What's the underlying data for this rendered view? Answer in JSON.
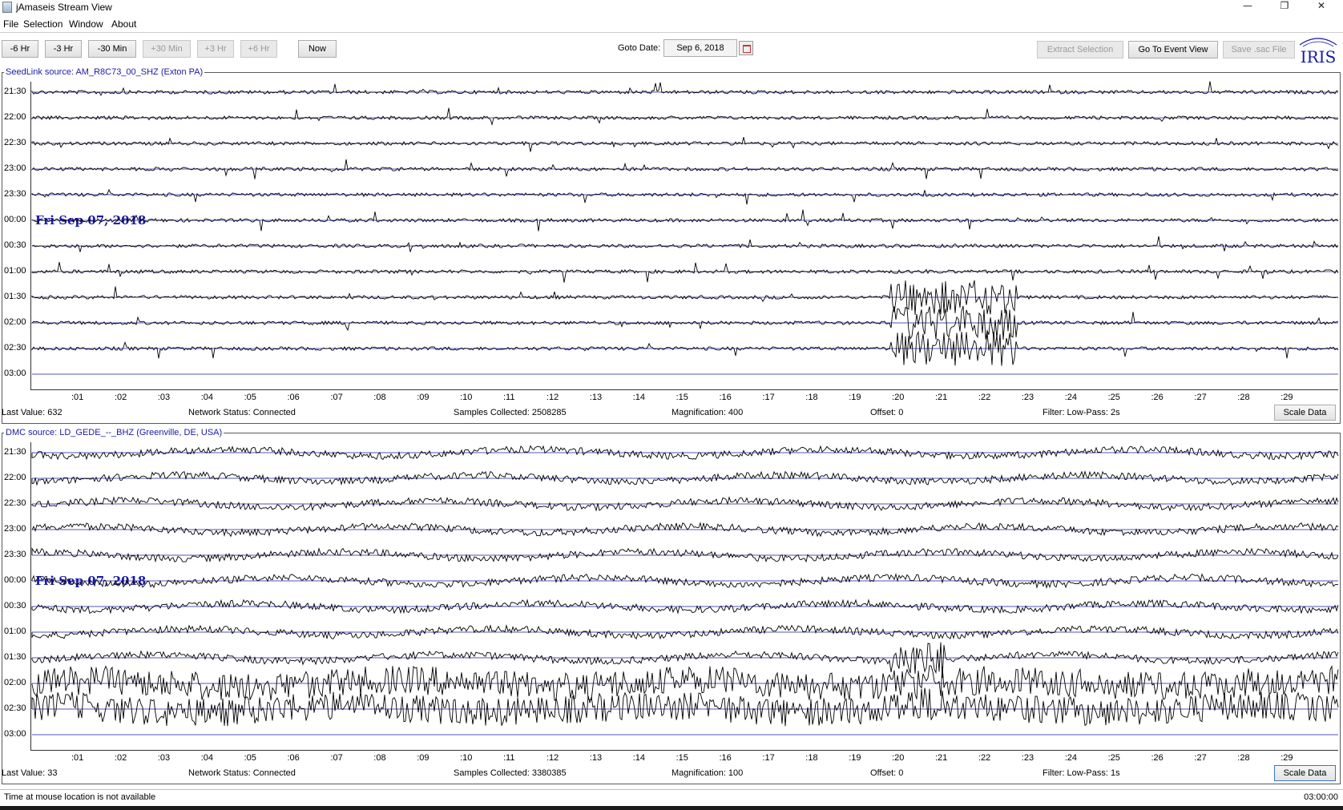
{
  "window": {
    "title": "jAmaseis Stream View",
    "minimize_icon": "minimize-icon",
    "maximize_icon": "restore-icon",
    "close_icon": "close-icon"
  },
  "menu": [
    "File",
    "Selection",
    "Window",
    "About"
  ],
  "toolbar": {
    "nav_buttons": [
      {
        "label": "-6 Hr",
        "enabled": true
      },
      {
        "label": "-3 Hr",
        "enabled": true
      },
      {
        "label": "-30 Min",
        "enabled": true
      },
      {
        "label": "+30 Min",
        "enabled": false
      },
      {
        "label": "+3 Hr",
        "enabled": false
      },
      {
        "label": "+6 Hr",
        "enabled": false
      },
      {
        "label": "Now",
        "enabled": true
      }
    ],
    "goto_label": "Goto Date:",
    "goto_value": "Sep 6, 2018",
    "extract_label": "Extract Selection",
    "event_view_label": "Go To Event View",
    "save_sac_label": "Save .sac File",
    "logo_text": "IRIS"
  },
  "row_labels": [
    "21:30",
    "22:00",
    "22:30",
    "23:00",
    "23:30",
    "00:00",
    "00:30",
    "01:00",
    "01:30",
    "02:00",
    "02:30",
    "03:00"
  ],
  "minute_ticks": [
    ":01",
    ":02",
    ":03",
    ":04",
    ":05",
    ":06",
    ":07",
    ":08",
    ":09",
    ":10",
    ":11",
    ":12",
    ":13",
    ":14",
    ":15",
    ":16",
    ":17",
    ":18",
    ":19",
    ":20",
    ":21",
    ":22",
    ":23",
    ":24",
    ":25",
    ":26",
    ":27",
    ":28",
    ":29"
  ],
  "panels": [
    {
      "source": "SeedLink source: AM_R8C73_00_SHZ (Exton PA)",
      "date_stamp": "Fri Sep 07, 2018",
      "status": {
        "last_value": "Last Value:  632",
        "network": "Network Status:  Connected",
        "samples": "Samples Collected:  2508285",
        "magnification": "Magnification:  400",
        "offset": "Offset:  0",
        "filter": "Filter:  Low-Pass: 2s"
      },
      "scale_label": "Scale Data"
    },
    {
      "source": "DMC source: LD_GEDE_--_BHZ (Greenville, DE, USA)",
      "date_stamp": "Fri Sep 07, 2018",
      "status": {
        "last_value": "Last Value:  33",
        "network": "Network Status:  Connected",
        "samples": "Samples Collected:  3380385",
        "magnification": "Magnification:  100",
        "offset": "Offset:  0",
        "filter": "Filter:  Low-Pass: 1s"
      },
      "scale_label": "Scale Data"
    }
  ],
  "statusbar": {
    "mouse_time": "Time at mouse location is not available",
    "clock": "03:00:00"
  },
  "colors": {
    "accent": "#1a1aa6",
    "trace": "#000000",
    "baseline": "#1a1aa6"
  }
}
